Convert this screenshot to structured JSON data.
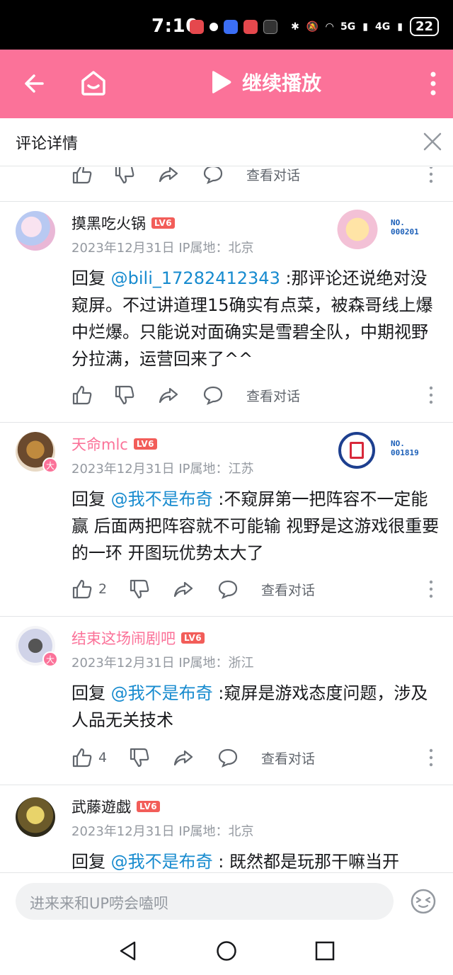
{
  "status_bar": {
    "time": "7:10",
    "signal_5g": "5G",
    "signal_4g": "4G",
    "battery": "22"
  },
  "topbar": {
    "play_label": "继续播放",
    "bg_color": "#fb7299"
  },
  "detail_header": {
    "title": "评论详情"
  },
  "actions": {
    "view_conversation": "查看对话"
  },
  "comments": [
    {
      "username": "摸黑吃火锅",
      "level": "LV6",
      "date": "2023年12月31日",
      "ip_label": "IP属地：北京",
      "fan_no": "NO.",
      "fan_id": "000201",
      "reply_prefix": "回复 ",
      "mention": "@bili_17282412343",
      "text": " :那评论还说绝对没窥屏。不过讲道理15确实有点菜，被森哥线上爆中烂爆。只能说对面确实是雪碧全队，中期视野分拉满，运营回来了^^",
      "likes": ""
    },
    {
      "username": "天命mlc",
      "level": "LV6",
      "date": "2023年12月31日",
      "ip_label": "IP属地：江苏",
      "fan_no": "NO.",
      "fan_id": "001819",
      "reply_prefix": "回复 ",
      "mention": "@我不是布奇",
      "text": " :不窥屏第一把阵容不一定能赢  后面两把阵容就不可能输   视野是这游戏很重要的一环  开图玩优势太大了",
      "likes": "2"
    },
    {
      "username": "结束这场闹剧吧",
      "level": "LV6",
      "date": "2023年12月31日",
      "ip_label": "IP属地：浙江",
      "reply_prefix": "回复 ",
      "mention": "@我不是布奇",
      "text": " :窥屏是游戏态度问题，涉及人品无关技术",
      "likes": "4"
    },
    {
      "username": "武藤遊戯",
      "level": "LV6",
      "date": "2023年12月31日",
      "ip_label": "IP属地：北京",
      "reply_prefix": "回复 ",
      "mention": "@我不是布奇",
      "text": " : 既然都是玩那干嘛当开"
    }
  ],
  "badge_big": "大",
  "input": {
    "placeholder": "进来来和UP唠会嗑呗"
  }
}
